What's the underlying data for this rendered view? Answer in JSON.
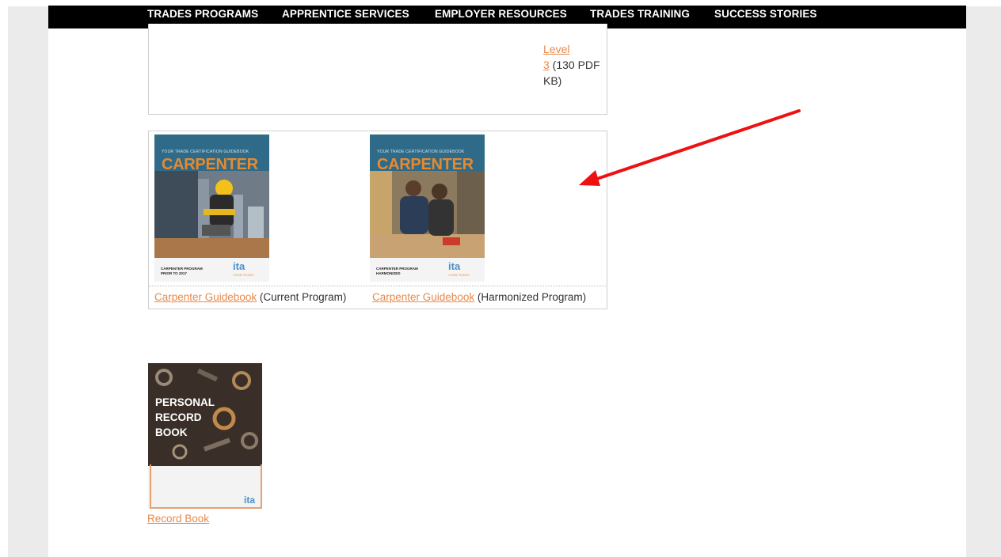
{
  "nav": {
    "items": [
      "TRADES PROGRAMS",
      "APPRENTICE SERVICES",
      "EMPLOYER RESOURCES",
      "TRADES TRAINING",
      "SUCCESS STORIES"
    ]
  },
  "level_box": {
    "link_part1": "Level",
    "link_part2": "3",
    "suffix_1": " (130 PDF",
    "suffix_2": "KB)"
  },
  "guidebooks": [
    {
      "cover": {
        "small_heading": "YOUR TRADE CERTIFICATION GUIDEBOOK",
        "title": "CARPENTER",
        "footer_line1": "CARPENTER PROGRAM",
        "footer_line2": "PRIOR TO 2017",
        "logo": "ita",
        "logo_tag": "YOUR TICKET."
      },
      "link": "Carpenter Guidebook",
      "suffix": " (Current Program)"
    },
    {
      "cover": {
        "small_heading": "YOUR TRADE CERTIFICATION GUIDEBOOK",
        "title": "CARPENTER",
        "footer_line1": "CARPENTER PROGRAM",
        "footer_line2": "HARMONIZED",
        "logo": "ita",
        "logo_tag": "YOUR TICKET."
      },
      "link": "Carpenter Guidebook",
      "suffix": " (Harmonized Program)"
    }
  ],
  "record_book": {
    "cover_line1": "PERSONAL",
    "cover_line2": "RECORD",
    "cover_line3": "BOOK",
    "logo": "ita",
    "link": "Record Book"
  },
  "colors": {
    "link": "#e8894c",
    "arrow": "#ee1111",
    "nav_bg": "#000000",
    "cover_orange": "#e8892f",
    "cover_blue": "#2f6b88"
  }
}
